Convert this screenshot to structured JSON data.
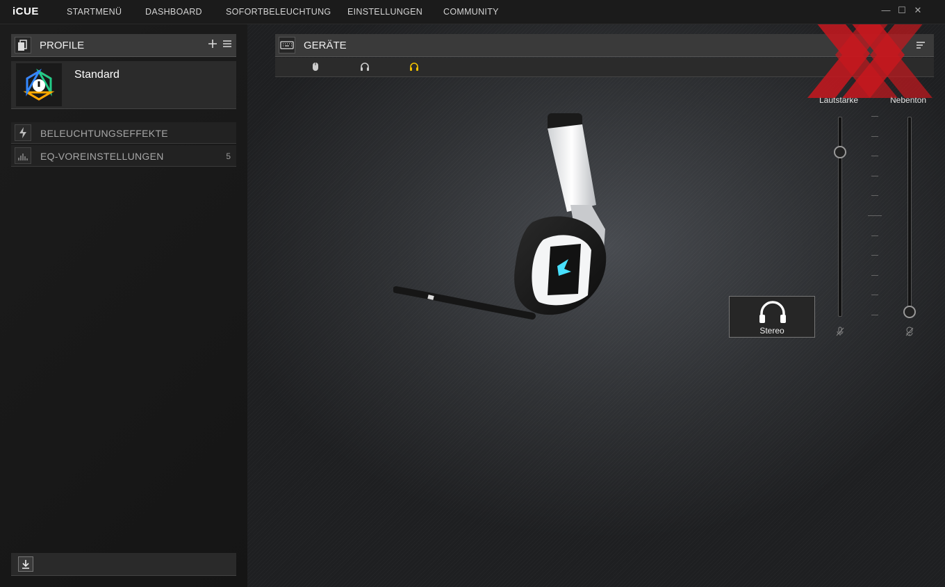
{
  "app": {
    "brand": "iCUE"
  },
  "nav": {
    "items": [
      "STARTMENÜ",
      "DASHBOARD",
      "SOFORTBELEUCHTUNG",
      "EINSTELLUNGEN",
      "COMMUNITY"
    ]
  },
  "window_controls": {
    "minimize": "—",
    "maximize": "☐",
    "close": "✕"
  },
  "profiles_panel": {
    "title": "PROFILE",
    "add_icon": "plus-icon",
    "menu_icon": "hamburger-icon",
    "profile": {
      "name": "Standard",
      "icon": "icue-logo-icon"
    }
  },
  "sections": [
    {
      "label": "BELEUCHTUNGSEFFEKTE",
      "icon": "lightning-icon",
      "count": ""
    },
    {
      "label": "EQ-VOREINSTELLUNGEN",
      "icon": "equalizer-icon",
      "count": "5"
    }
  ],
  "devices_panel": {
    "title": "GERÄTE",
    "device_tabs": [
      {
        "icon": "mouse-icon",
        "active": false
      },
      {
        "icon": "headset-icon",
        "active": false
      },
      {
        "icon": "headset-icon",
        "active": true
      }
    ]
  },
  "sliders": {
    "volume": {
      "label": "Lautstärke",
      "level": 0.86,
      "icon": "microphone-icon"
    },
    "sidetone": {
      "label": "Nebenton",
      "level": 0.0,
      "icon": "microphone-muted-icon"
    }
  },
  "stereo_button": {
    "label": "Stereo",
    "icon": "headphones-icon"
  },
  "colors": {
    "accent_active": "#f0c000",
    "watermark": "#c8181e"
  }
}
